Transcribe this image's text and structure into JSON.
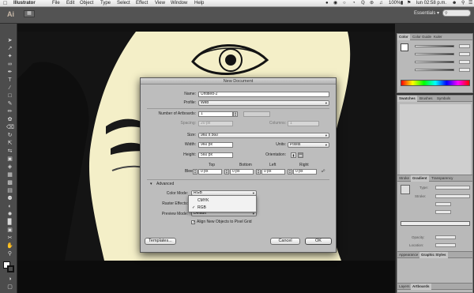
{
  "menubar": {
    "apple": "",
    "app": "Illustrator",
    "items": [
      "File",
      "Edit",
      "Object",
      "Type",
      "Select",
      "Effect",
      "View",
      "Window",
      "Help"
    ],
    "battery": "100%",
    "clock": "lun 02:58 p.m."
  },
  "appbar": {
    "logo": "Ai",
    "workspace": "Essentials ▾"
  },
  "panels": {
    "color_tabs": [
      "Color",
      "Color Guide",
      "Kuler"
    ],
    "swatches_tabs": [
      "Swatches",
      "Brushes",
      "Symbols"
    ],
    "stroke_tabs": [
      "Stroke",
      "Gradient",
      "Transparency"
    ],
    "gradient_labels": {
      "type": "Type:",
      "stroke": "Stroke:",
      "opacity": "Opacity:",
      "location": "Location:"
    },
    "appearance_tabs": [
      "Appearance",
      "Graphic Styles"
    ],
    "layers_tabs": [
      "Layers",
      "Artboards"
    ]
  },
  "dialog": {
    "title": "New Document",
    "name_label": "Name:",
    "name_value": "Untitled-2",
    "profile_label": "Profile:",
    "profile_value": "Web",
    "artboards_label": "Number of Artboards:",
    "artboards_value": "1",
    "spacing_label": "Spacing:",
    "spacing_value": "20 px",
    "columns_label": "Columns:",
    "columns_value": "1",
    "size_label": "Size:",
    "size_value": "960 x 560",
    "width_label": "Width:",
    "width_value": "960 px",
    "units_label": "Units:",
    "units_value": "Pixels",
    "height_label": "Height:",
    "height_value": "560 px",
    "orientation_label": "Orientation:",
    "bleed_label": "Bleed:",
    "bleed": [
      {
        "label": "Top",
        "value": "0 px"
      },
      {
        "label": "Bottom",
        "value": "0 px"
      },
      {
        "label": "Left",
        "value": "0 px"
      },
      {
        "label": "Right",
        "value": "0 px"
      }
    ],
    "advanced_label": "Advanced",
    "color_mode_label": "Color Mode:",
    "color_mode_value": "RGB",
    "raster_label": "Raster Effects:",
    "preview_label": "Preview Mode:",
    "preview_value": "Default",
    "align_label": "Align New Objects to Pixel Grid",
    "templates_button": "Templates...",
    "cancel_button": "Cancel",
    "ok_button": "OK"
  },
  "color_mode_menu": {
    "options": [
      "CMYK",
      "RGB"
    ],
    "selected": "RGB"
  },
  "colors": {
    "photo_background": "#f4efc8",
    "ink": "#141414",
    "dialog": "#bdbdbd",
    "ui_dark": "#3a3a3a"
  }
}
